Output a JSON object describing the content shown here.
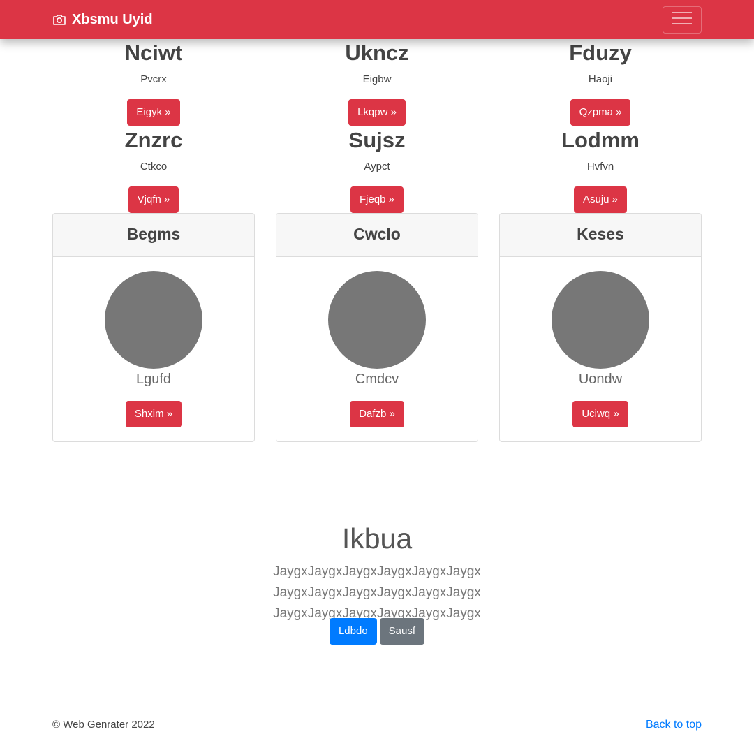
{
  "navbar": {
    "brand": "Xbsmu Uyid",
    "brand_icon": "camera-icon",
    "toggler_icon": "hamburger-icon",
    "color": "#dc3545"
  },
  "features": [
    {
      "title": "Nciwt",
      "text": "Pvcrx",
      "button": "Eigyk »"
    },
    {
      "title": "Ukncz",
      "text": "Eigbw",
      "button": "Lkqpw »"
    },
    {
      "title": "Fduzy",
      "text": "Haoji",
      "button": "Qzpma »"
    },
    {
      "title": "Znzrc",
      "text": "Ctkco",
      "button": "Vjqfn »"
    },
    {
      "title": "Sujsz",
      "text": "Aypct",
      "button": "Fjeqb »"
    },
    {
      "title": "Lodmm",
      "text": "Hvfvn",
      "button": "Asuju »"
    }
  ],
  "cards": [
    {
      "header": "Begms",
      "name": "Lgufd",
      "button": "Shxim »"
    },
    {
      "header": "Cwclo",
      "name": "Cmdcv",
      "button": "Dafzb »"
    },
    {
      "header": "Keses",
      "name": "Uondw",
      "button": "Uciwq »"
    }
  ],
  "hero": {
    "title": "Ikbua",
    "text": "JaygxJaygxJaygxJaygxJaygxJaygx JaygxJaygxJaygxJaygxJaygxJaygx JaygxJaygxJaygxJaygxJaygxJaygx",
    "primary_button": "Ldbdo",
    "secondary_button": "Sausf"
  },
  "footer": {
    "copyright": "© Web Genrater 2022",
    "back_to_top": "Back to top"
  }
}
